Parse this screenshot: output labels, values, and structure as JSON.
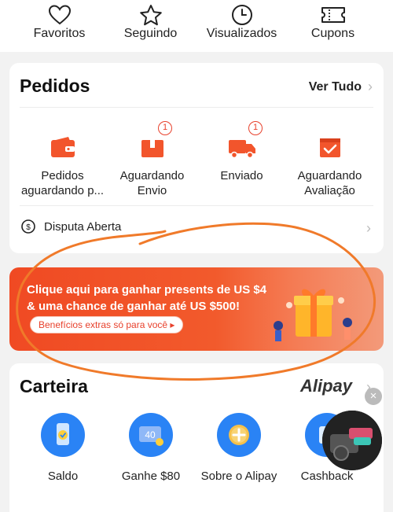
{
  "top_nav": {
    "items": [
      {
        "label": "Favoritos",
        "icon": "heart-icon"
      },
      {
        "label": "Seguindo",
        "icon": "star-icon"
      },
      {
        "label": "Visualizados",
        "icon": "clock-icon"
      },
      {
        "label": "Cupons",
        "icon": "coupon-icon"
      }
    ]
  },
  "orders": {
    "title": "Pedidos",
    "see_all": "Ver Tudo",
    "items": [
      {
        "label": "Pedidos aguardando p...",
        "icon": "wallet-icon",
        "badge": ""
      },
      {
        "label": "Aguardando Envio",
        "icon": "package-icon",
        "badge": "1"
      },
      {
        "label": "Enviado",
        "icon": "truck-icon",
        "badge": "1"
      },
      {
        "label": "Aguardando Avaliação",
        "icon": "review-icon",
        "badge": ""
      }
    ],
    "dispute_label": "Disputa Aberta"
  },
  "banner": {
    "text": "Clique aqui para ganhar presents de US $4 & uma chance de ganhar até US $500!",
    "button": "Benefícios extras só para você ▸"
  },
  "wallet": {
    "title": "Carteira",
    "provider": "Alipay",
    "items": [
      {
        "label": "Saldo",
        "icon": "phone-balance-icon"
      },
      {
        "label": "Ganhe $80",
        "icon": "card-40-icon",
        "icon_text": "40"
      },
      {
        "label": "Sobre o Alipay",
        "icon": "plus-coin-icon"
      },
      {
        "label": "Cashback",
        "icon": "cashback-icon"
      }
    ]
  },
  "colors": {
    "accent": "#e8412c",
    "banner": "#f04a23",
    "wallet_blue": "#2a83f5",
    "annotation": "#f07a2a"
  }
}
